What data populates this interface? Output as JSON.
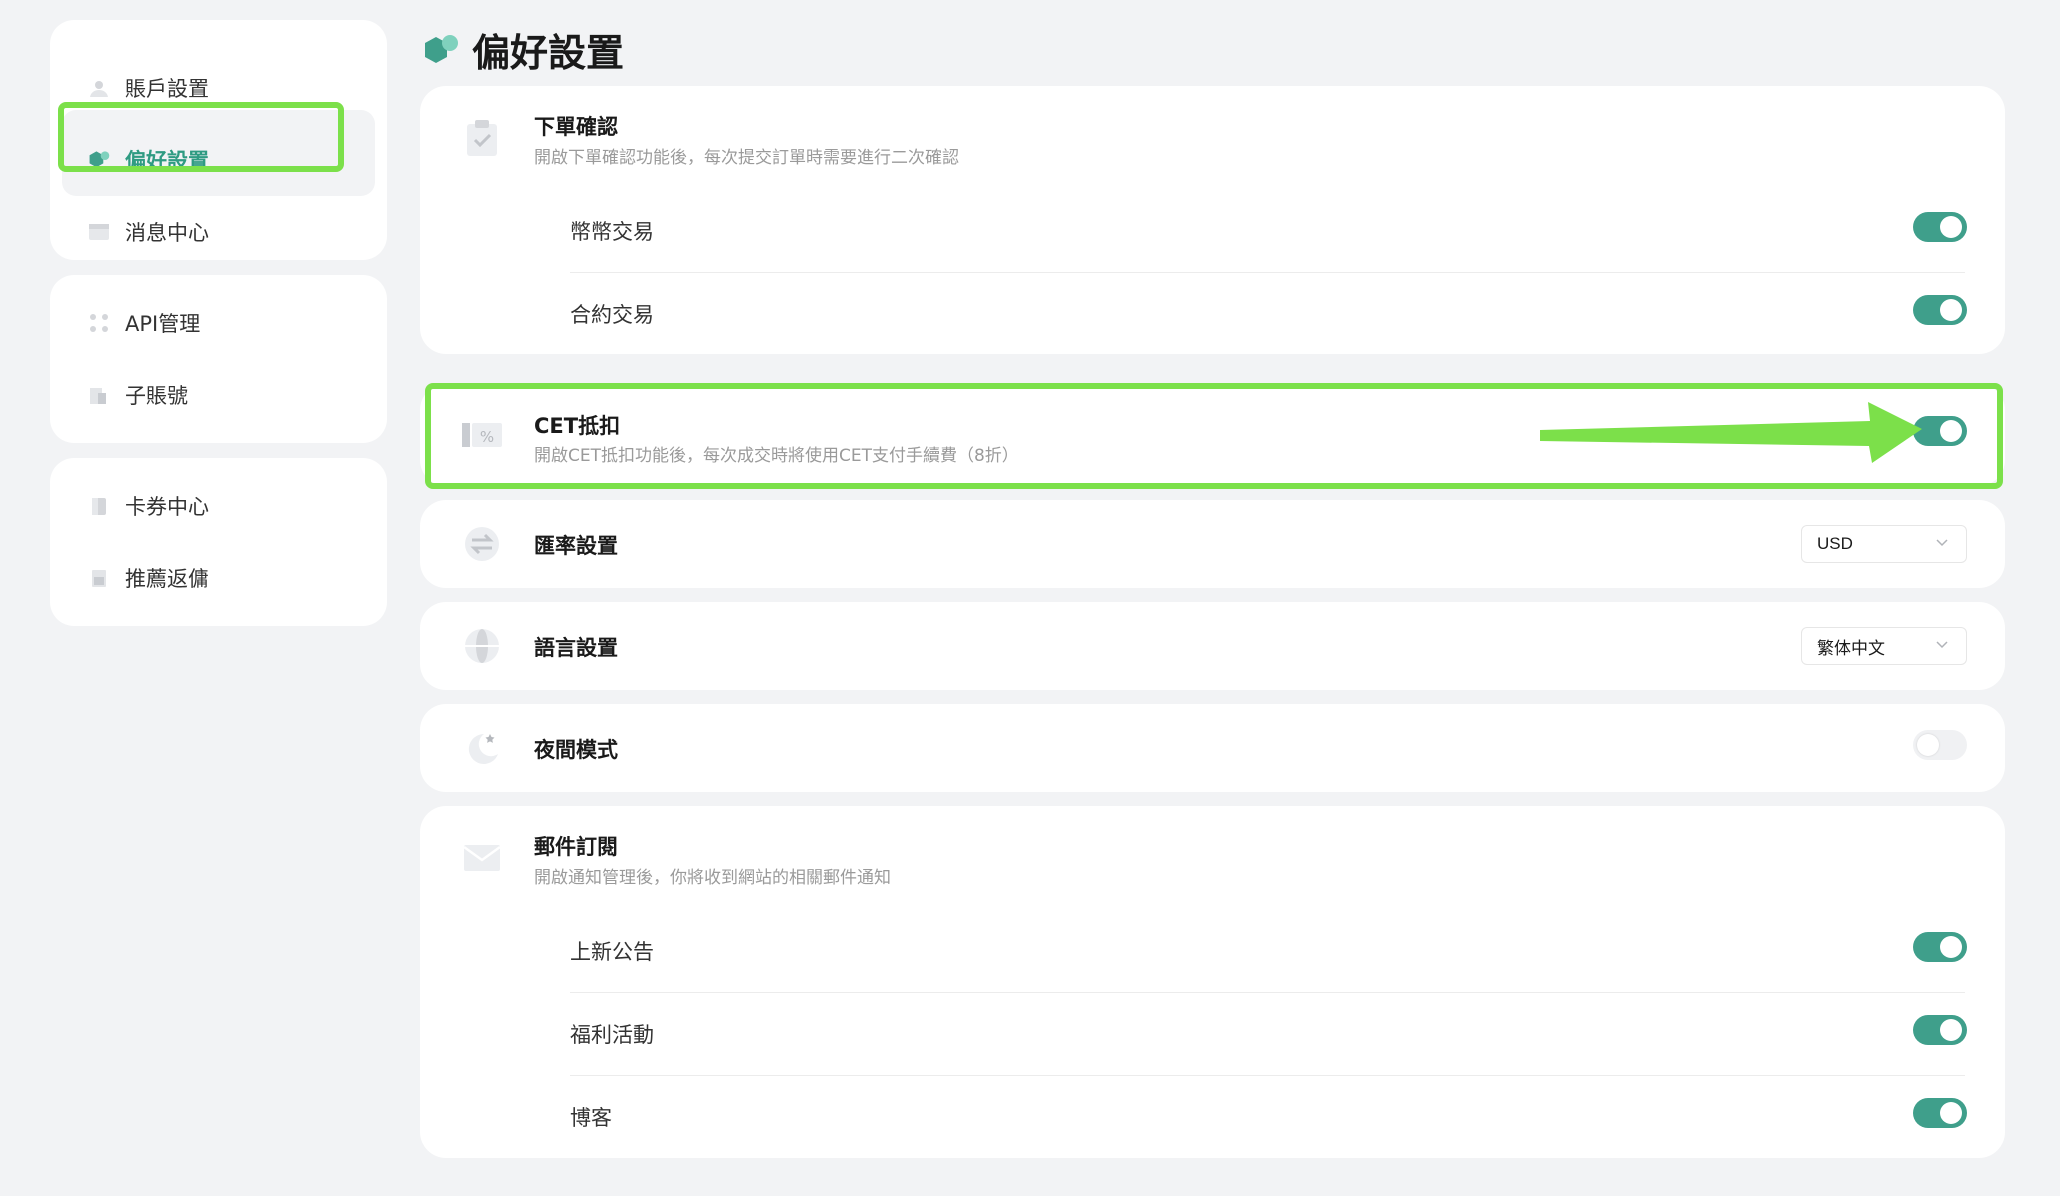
{
  "sidebar": {
    "groups": [
      [
        {
          "label": "賬戶設置",
          "icon": "user-icon"
        },
        {
          "label": "偏好設置",
          "icon": "preferences-icon",
          "active": true
        },
        {
          "label": "消息中心",
          "icon": "message-icon"
        }
      ],
      [
        {
          "label": "API管理",
          "icon": "api-icon"
        },
        {
          "label": "子賬號",
          "icon": "sub-account-icon"
        }
      ],
      [
        {
          "label": "卡券中心",
          "icon": "coupon-icon"
        },
        {
          "label": "推薦返傭",
          "icon": "referral-icon"
        }
      ]
    ]
  },
  "page": {
    "title": "偏好設置"
  },
  "order_confirm": {
    "title": "下單確認",
    "desc": "開啟下單確認功能後，每次提交訂單時需要進行二次確認",
    "rows": [
      {
        "label": "幣幣交易",
        "on": true
      },
      {
        "label": "合約交易",
        "on": true
      }
    ]
  },
  "cet_deduction": {
    "title": "CET抵扣",
    "desc": "開啟CET抵扣功能後，每次成交時將使用CET支付手續費（8折）",
    "on": true
  },
  "exchange_rate": {
    "title": "匯率設置",
    "value": "USD"
  },
  "language": {
    "title": "語言設置",
    "value": "繁体中文"
  },
  "night_mode": {
    "title": "夜間模式",
    "on": false
  },
  "email_sub": {
    "title": "郵件訂閱",
    "desc": "開啟通知管理後，你將收到網站的相關郵件通知",
    "rows": [
      {
        "label": "上新公告",
        "on": true
      },
      {
        "label": "福利活動",
        "on": true
      },
      {
        "label": "博客",
        "on": true
      }
    ]
  },
  "colors": {
    "accent": "#3f9f8b",
    "highlight": "#7ce04a"
  }
}
